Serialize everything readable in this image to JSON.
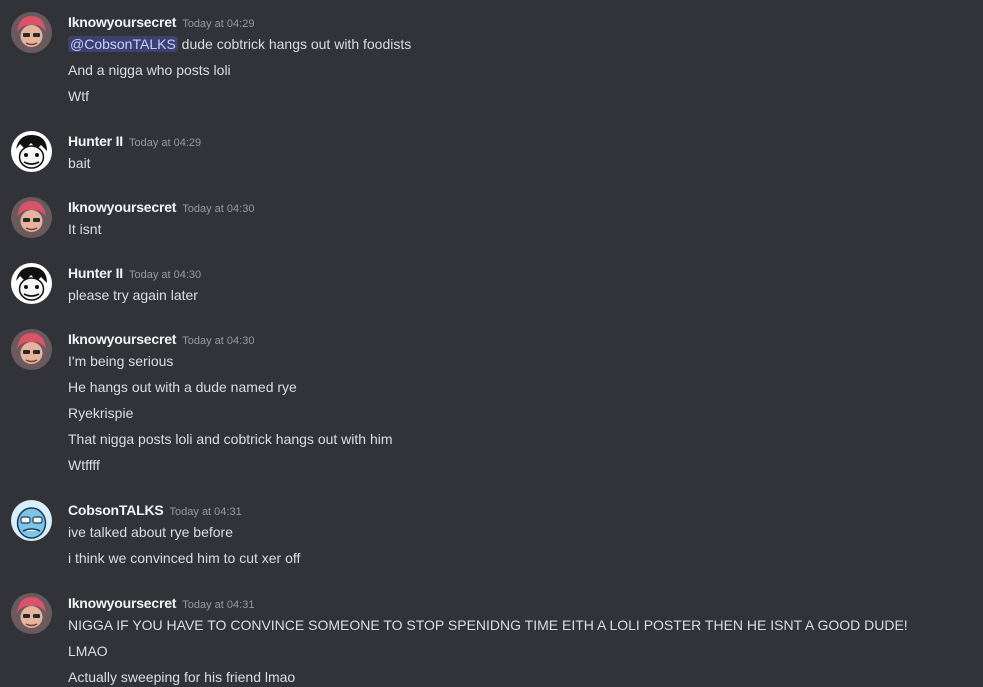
{
  "messages": [
    {
      "author": "Iknowyoursecret",
      "timestamp": "Today at 04:29",
      "avatar": "pink-hair-avatar-icon",
      "mention": "@CobsonTALKS",
      "first_line_rest": " dude cobtrick hangs out with foodists",
      "lines": [
        "And a nigga who posts loli",
        "Wtf"
      ]
    },
    {
      "author": "Hunter II",
      "timestamp": "Today at 04:29",
      "avatar": "cartoon-face-avatar-icon",
      "lines": [
        "bait"
      ]
    },
    {
      "author": "Iknowyoursecret",
      "timestamp": "Today at 04:30",
      "avatar": "pink-hair-avatar-icon",
      "lines": [
        "It isnt"
      ]
    },
    {
      "author": "Hunter II",
      "timestamp": "Today at 04:30",
      "avatar": "cartoon-face-avatar-icon",
      "lines": [
        "please try again later"
      ]
    },
    {
      "author": "Iknowyoursecret",
      "timestamp": "Today at 04:30",
      "avatar": "pink-hair-avatar-icon",
      "lines": [
        "I'm being serious",
        "He hangs out with a dude named rye",
        "Ryekrispie",
        "That nigga posts loli and cobtrick hangs out with him",
        "Wtffff"
      ]
    },
    {
      "author": "CobsonTALKS",
      "timestamp": "Today at 04:31",
      "avatar": "blue-cobson-avatar-icon",
      "lines": [
        "ive talked about rye before",
        "i think we convinced him to cut xer off"
      ]
    },
    {
      "author": "Iknowyoursecret",
      "timestamp": "Today at 04:31",
      "avatar": "pink-hair-avatar-icon",
      "lines": [
        "NIGGA IF YOU HAVE TO CONVINCE SOMEONE TO STOP SPENIDNG TIME EITH A LOLI POSTER THEN HE ISNT A GOOD DUDE!",
        "LMAO",
        "Actually sweeping for his friend lmao"
      ]
    }
  ],
  "colors": {
    "background": "#313338",
    "username": "#f2f3f5",
    "text": "#dbdee1",
    "timestamp": "#949ba4",
    "mention_bg": "#3c4270",
    "mention_text": "#c9cdfb"
  }
}
